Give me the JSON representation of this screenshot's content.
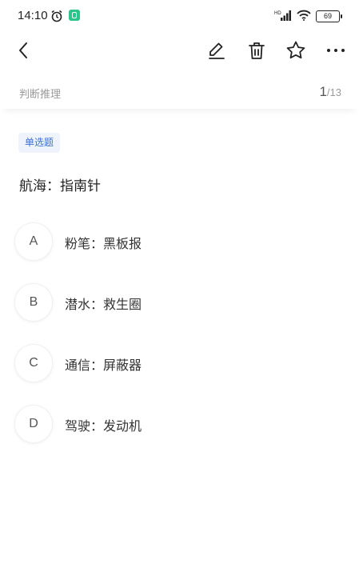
{
  "status_bar": {
    "time": "14:10",
    "battery": "69"
  },
  "toolbar": {
    "icons": [
      "back-icon",
      "edit-icon",
      "trash-icon",
      "star-icon",
      "more-icon"
    ]
  },
  "subheader": {
    "category": "判断推理",
    "progress_current": "1",
    "progress_total": "/13"
  },
  "question": {
    "type_badge": "单选题",
    "stem": "航海：指南针",
    "options": [
      {
        "letter": "A",
        "text": "粉笔：黑板报"
      },
      {
        "letter": "B",
        "text": "潜水：救生圈"
      },
      {
        "letter": "C",
        "text": "通信：屏蔽器"
      },
      {
        "letter": "D",
        "text": "驾驶：发动机"
      }
    ]
  }
}
